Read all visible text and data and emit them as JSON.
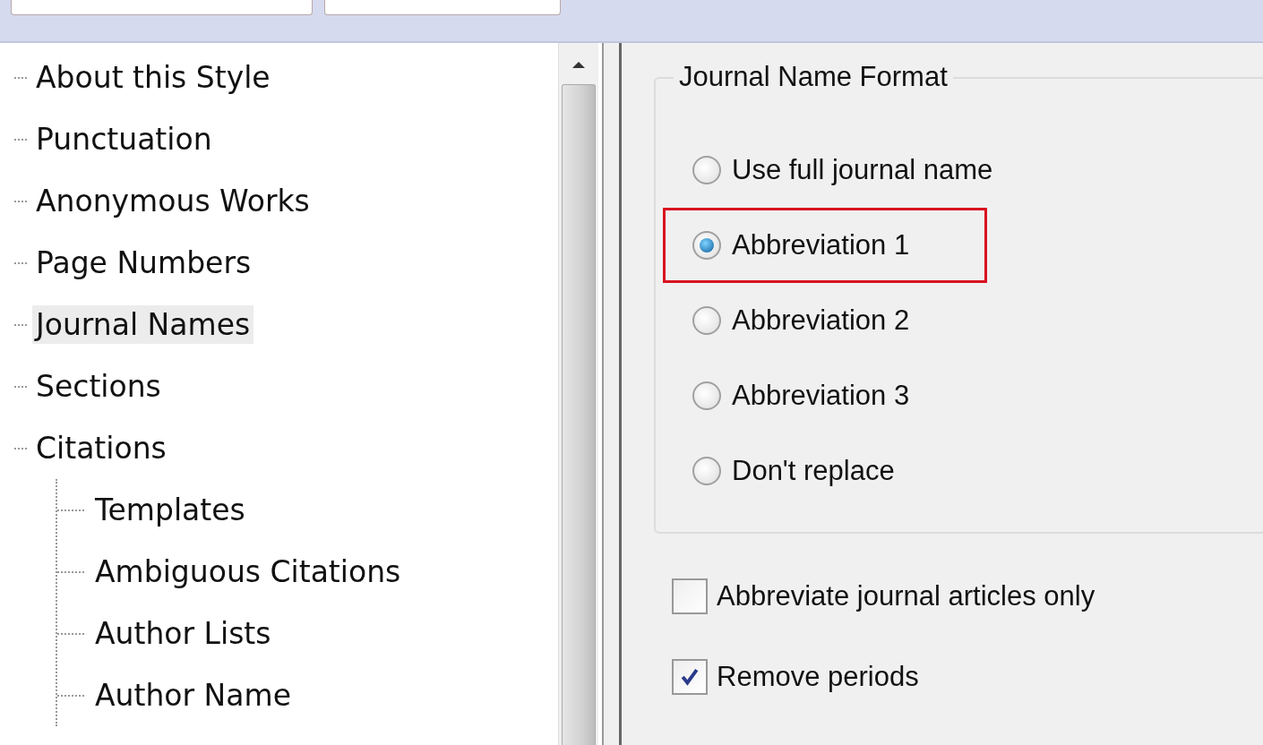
{
  "tree": [
    {
      "label": "About this Style",
      "selected": false
    },
    {
      "label": "Punctuation",
      "selected": false
    },
    {
      "label": "Anonymous Works",
      "selected": false
    },
    {
      "label": "Page Numbers",
      "selected": false
    },
    {
      "label": "Journal Names",
      "selected": true
    },
    {
      "label": "Sections",
      "selected": false
    },
    {
      "label": "Citations",
      "selected": false,
      "children": [
        {
          "label": "Templates",
          "selected": false
        },
        {
          "label": "Ambiguous Citations",
          "selected": false
        },
        {
          "label": "Author Lists",
          "selected": false
        },
        {
          "label": "Author Name",
          "selected": false
        }
      ]
    }
  ],
  "group": {
    "title": "Journal Name Format",
    "options": [
      {
        "label": "Use full journal name",
        "selected": false,
        "highlighted": false
      },
      {
        "label": "Abbreviation 1",
        "selected": true,
        "highlighted": true
      },
      {
        "label": "Abbreviation 2",
        "selected": false,
        "highlighted": false
      },
      {
        "label": "Abbreviation 3",
        "selected": false,
        "highlighted": false
      },
      {
        "label": "Don't replace",
        "selected": false,
        "highlighted": false
      }
    ]
  },
  "checkboxes": [
    {
      "label": "Abbreviate journal articles only",
      "checked": false
    },
    {
      "label": "Remove periods",
      "checked": true
    }
  ]
}
